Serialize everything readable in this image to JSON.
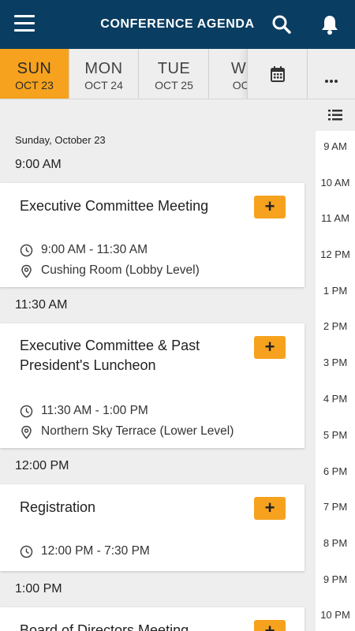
{
  "header": {
    "title": "CONFERENCE AGENDA"
  },
  "days": [
    {
      "dow": "SUN",
      "date": "OCT 23"
    },
    {
      "dow": "MON",
      "date": "OCT 24"
    },
    {
      "dow": "TUE",
      "date": "OCT 25"
    },
    {
      "dow": "WE",
      "date": "OCT"
    }
  ],
  "selected_day_label": "Sunday, October 23",
  "sessions": [
    {
      "time_heading": "9:00 AM",
      "title": "Executive Committee Meeting",
      "time": "9:00 AM - 11:30 AM",
      "location": "Cushing Room (Lobby Level)",
      "add": "+"
    },
    {
      "time_heading": "11:30 AM",
      "title": "Executive Committee & Past President's Luncheon",
      "time": "11:30 AM - 1:00 PM",
      "location": "Northern Sky Terrace (Lower Level)",
      "add": "+"
    },
    {
      "time_heading": "12:00 PM",
      "title": "Registration",
      "time": "12:00 PM - 7:30 PM",
      "add": "+"
    },
    {
      "time_heading": "1:00 PM",
      "title": "Board of Directors Meeting",
      "add": "+"
    }
  ],
  "rail_hours": [
    "9 AM",
    "10 AM",
    "11 AM",
    "12 PM",
    "1 PM",
    "2 PM",
    "3 PM",
    "4 PM",
    "5 PM",
    "6 PM",
    "7 PM",
    "8 PM",
    "9 PM",
    "10 PM"
  ],
  "colors": {
    "header_bg": "#0a3d62",
    "accent": "#f6a21e",
    "background": "#eeeeee"
  },
  "icons": [
    "menu-icon",
    "search-icon",
    "bell-icon",
    "calendar-icon",
    "more-icon",
    "list-icon",
    "clock-icon",
    "location-pin-icon"
  ]
}
